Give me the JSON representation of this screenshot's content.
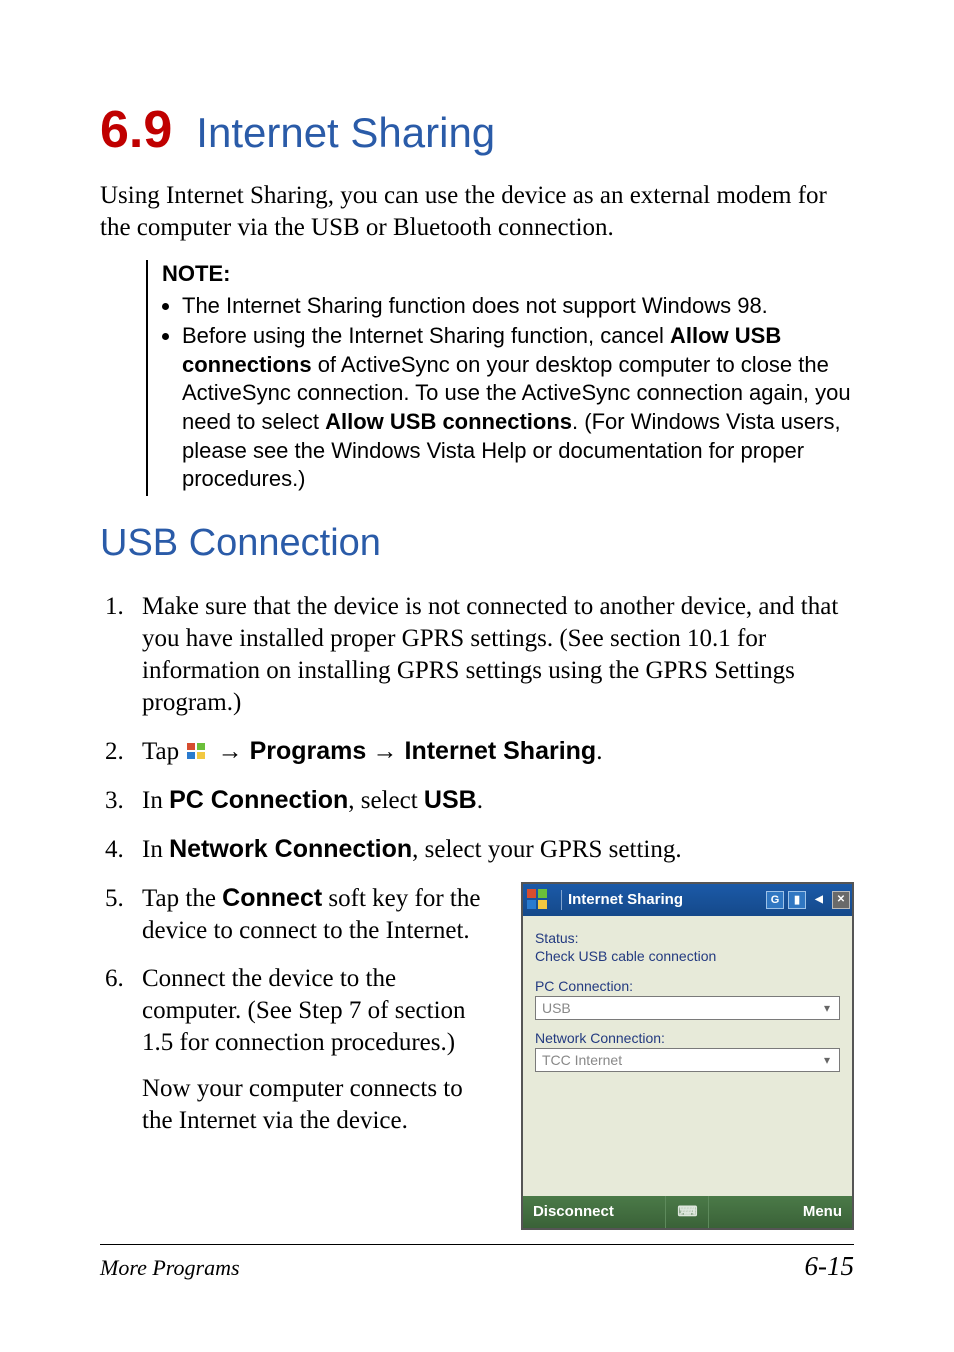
{
  "heading": {
    "number": "6.9",
    "title": "Internet Sharing"
  },
  "intro": "Using Internet Sharing, you can use the device as an external modem for the computer via the USB or Bluetooth connection.",
  "note": {
    "label": "NOTE:",
    "item1": "The Internet Sharing function does not support Windows 98.",
    "item2_pre": "Before using the Internet Sharing function, cancel ",
    "item2_bold1": "Allow USB connections",
    "item2_mid": " of ActiveSync on your desktop computer to close the ActiveSync connection. To use the ActiveSync connection again, you need to select ",
    "item2_bold2": "Allow USB connections",
    "item2_post": ". (For Windows Vista users, please see the Windows Vista Help or documentation for proper procedures.)"
  },
  "subheading": "USB Connection",
  "steps": {
    "s1": "Make sure that the device is not connected to another device, and that you have installed proper GPRS settings. (See section 10.1 for information on installing GPRS settings using the GPRS Settings program.)",
    "s2": {
      "pre": "Tap ",
      "arrow": " → ",
      "b1": "Programs",
      "b2": "Internet Sharing",
      "post": "."
    },
    "s3": {
      "pre": "In ",
      "b1": "PC Connection",
      "mid": ", select ",
      "b2": "USB",
      "post": "."
    },
    "s4": {
      "pre": "In ",
      "b1": "Network Connection",
      "post": ", select your GPRS setting."
    },
    "s5": {
      "pre": "Tap the ",
      "b1": "Connect",
      "post": " soft key for the device to connect to the Internet."
    },
    "s6": "Connect the device to the computer. (See Step 7 of section 1.5 for connection procedures.)",
    "s6b": "Now your computer connects to the Internet via the device."
  },
  "screenshot": {
    "title": "Internet Sharing",
    "status_icons": {
      "g": "G",
      "sig": "▘",
      "vol": "v",
      "close": "x"
    },
    "status_label": "Status:",
    "status_value": "Check USB cable connection",
    "pc_label": "PC Connection:",
    "pc_value": "USB",
    "net_label": "Network Connection:",
    "net_value": "TCC Internet",
    "soft_left": "Disconnect",
    "soft_right": "Menu"
  },
  "footer": {
    "left": "More Programs",
    "right": "6-15"
  }
}
